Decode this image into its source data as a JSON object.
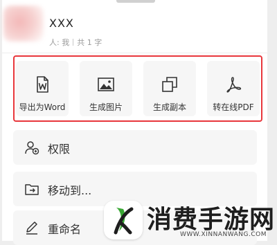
{
  "header": {
    "title": "XXX",
    "meta_owner": "人: 我",
    "meta_count": "共 1 字"
  },
  "actions": [
    {
      "label": "导出为Word",
      "icon": "word-file-icon"
    },
    {
      "label": "生成图片",
      "icon": "image-icon"
    },
    {
      "label": "生成副本",
      "icon": "copy-icon"
    },
    {
      "label": "转在线PDF",
      "icon": "pdf-icon"
    }
  ],
  "menu": [
    {
      "label": "权限",
      "icon": "user-permission-icon"
    },
    {
      "label": "移动到...",
      "icon": "move-folder-icon"
    },
    {
      "label": "重命名",
      "icon": "pencil-icon"
    }
  ],
  "watermark": {
    "text": "消费手游网",
    "url": "WWW.XINNANWANG.COM"
  },
  "colors": {
    "highlight": "#e8363b",
    "tile_bg": "#f6f6f6",
    "logo_green": "#3aa835"
  }
}
